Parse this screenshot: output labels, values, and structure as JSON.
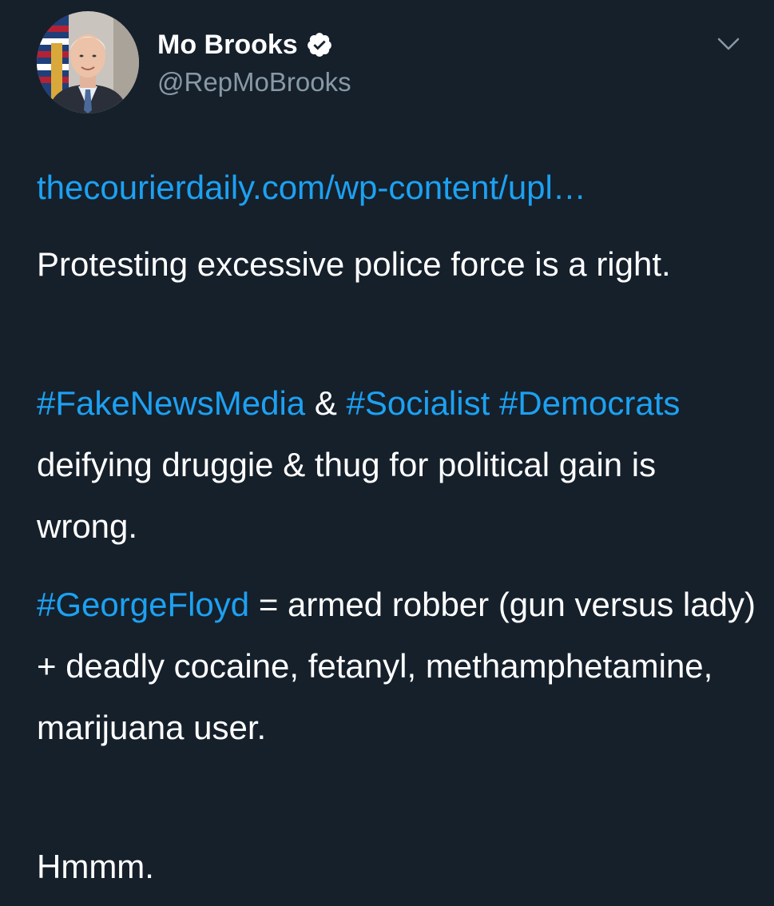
{
  "author": {
    "name": "Mo Brooks",
    "handle": "@RepMoBrooks",
    "verified": true,
    "avatar_icon": "profile-photo"
  },
  "menu": {
    "icon": "chevron-down-icon"
  },
  "colors": {
    "background": "#15202b",
    "text": "#ffffff",
    "secondary_text": "#8899a6",
    "link": "#1da1f2"
  },
  "tweet": {
    "link_text": "thecourierdaily.com/wp-content/upl…",
    "p1": "Protesting excessive police force is a right.",
    "p2": {
      "tag1": "#FakeNewsMedia",
      "amp": " & ",
      "tag2": "#Socialist",
      "tag3": "#Democrats",
      "rest": " deifying druggie & thug for political gain is wrong."
    },
    "p3": {
      "tag": "#GeorgeFloyd",
      "rest": " = armed robber (gun versus lady) + deadly cocaine, fetanyl, methamphetamine, marijuana user."
    },
    "p4": "Hmmm."
  }
}
